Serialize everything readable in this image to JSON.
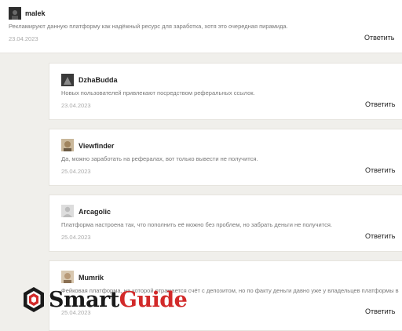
{
  "comments": [
    {
      "username": "malek",
      "text": "Рекламируют данную платформу как надёжный ресурс для заработка, хотя это очередная пирамида.",
      "date": "23.04.2023",
      "reply_label": "Ответить"
    },
    {
      "username": "DzhaBudda",
      "text": "Новых пользователей привлекают посредством реферальных ссылок.",
      "date": "23.04.2023",
      "reply_label": "Ответить"
    },
    {
      "username": "Viewfinder",
      "text": "Да, можно заработать на рефералах, вот только вывести не получится.",
      "date": "25.04.2023",
      "reply_label": "Ответить"
    },
    {
      "username": "Arcagolic",
      "text": "Платформа настроена так, что пополнить её можно без проблем, но забрать деньги не получится.",
      "date": "25.04.2023",
      "reply_label": "Ответить"
    },
    {
      "username": "Mumrik",
      "text": "Фейковая платформа, на которой отражается счёт с депозитом, но по факту деньги давно уже у владельцев платформы в",
      "date": "25.04.2023",
      "reply_label": "Ответить"
    }
  ],
  "watermark": {
    "part1": "Smart",
    "part2": "Guide"
  },
  "colors": {
    "background": "#f0efeb",
    "card": "#ffffff",
    "logo_red": "#d22a2a"
  }
}
